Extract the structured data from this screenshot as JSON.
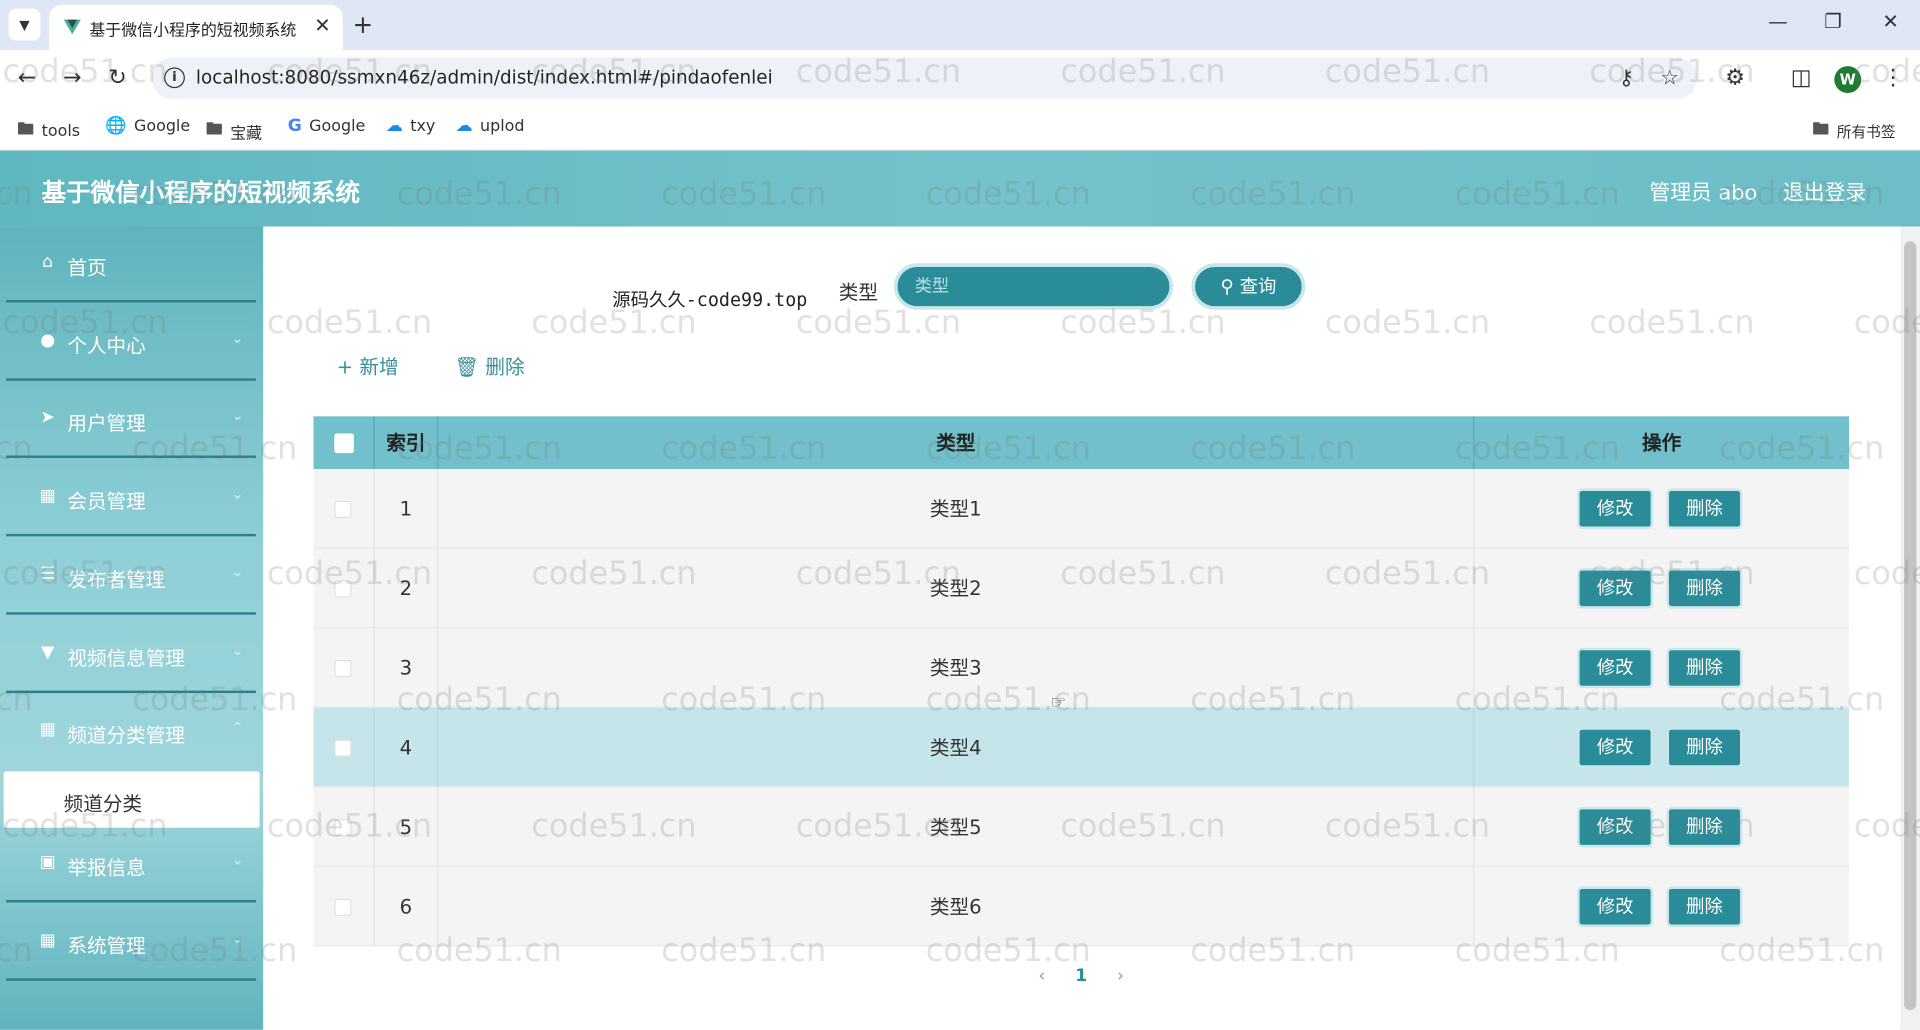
{
  "browser": {
    "tab_title": "基于微信小程序的短视频系统",
    "url": "localhost:8080/ssmxn46z/admin/dist/index.html#/pindaofenlei",
    "bookmarks": [
      "tools",
      "Google",
      "宝藏",
      "Google",
      "txy",
      "uplod"
    ],
    "all_bookmarks": "所有书签",
    "profile_initial": "W"
  },
  "header": {
    "title": "基于微信小程序的短视频系统",
    "user": "管理员 abo",
    "logout": "退出登录"
  },
  "sidebar": {
    "items": [
      {
        "label": "首页",
        "icon": "home-icon"
      },
      {
        "label": "个人中心",
        "icon": "user-icon"
      },
      {
        "label": "用户管理",
        "icon": "send-icon"
      },
      {
        "label": "会员管理",
        "icon": "grid-icon"
      },
      {
        "label": "发布者管理",
        "icon": "list-icon"
      },
      {
        "label": "视频信息管理",
        "icon": "pin-icon"
      },
      {
        "label": "频道分类管理",
        "icon": "grid-icon"
      },
      {
        "label": "举报信息",
        "icon": "briefcase-icon"
      },
      {
        "label": "系统管理",
        "icon": "grid-icon"
      }
    ],
    "active_sub": "频道分类"
  },
  "search": {
    "label": "类型",
    "placeholder": "类型",
    "button": "查询"
  },
  "toolbar": {
    "add": "新增",
    "delete": "删除"
  },
  "table": {
    "columns": [
      "索引",
      "类型",
      "操作"
    ],
    "rows": [
      {
        "index": "1",
        "type": "类型1"
      },
      {
        "index": "2",
        "type": "类型2"
      },
      {
        "index": "3",
        "type": "类型3"
      },
      {
        "index": "4",
        "type": "类型4"
      },
      {
        "index": "5",
        "type": "类型5"
      },
      {
        "index": "6",
        "type": "类型6"
      }
    ],
    "edit_label": "修改",
    "delete_label": "删除",
    "highlighted_row": 4
  },
  "pagination": {
    "current_page": "1"
  },
  "overlay_text": "源码久久-code99.top",
  "watermark": "code51.cn",
  "colors": {
    "accent": "#2a8c99",
    "header": "#6dbec8",
    "table_header": "#71c0cb",
    "row_highlight": "#c5e5ea"
  }
}
